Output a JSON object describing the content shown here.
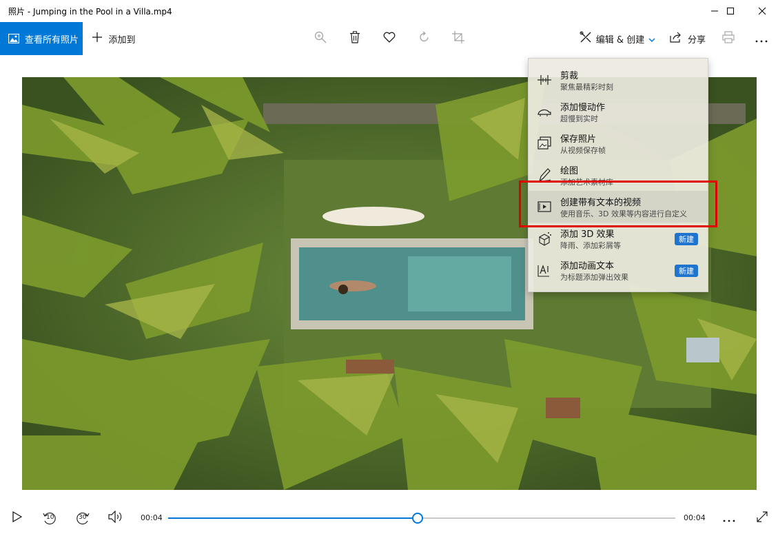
{
  "window": {
    "title": "照片 - Jumping in the Pool in a Villa.mp4",
    "minimize_icon": "minimize-icon",
    "maximize_icon": "maximize-icon",
    "close_icon": "close-icon"
  },
  "toolbar": {
    "see_all_label": "查看所有照片",
    "add_to_label": "添加到",
    "edit_create_label": "编辑 & 创建",
    "share_label": "分享",
    "accent_color": "#0078d7",
    "icons": [
      "zoom-icon",
      "delete-icon",
      "favorite-icon",
      "rotate-icon",
      "crop-icon",
      "print-icon",
      "more-icon"
    ]
  },
  "menu": {
    "items": [
      {
        "title": "剪裁",
        "subtitle": "聚焦最精彩时刻",
        "icon": "trim-icon",
        "badge": ""
      },
      {
        "title": "添加慢动作",
        "subtitle": "超慢到实时",
        "icon": "slow-motion-icon",
        "badge": ""
      },
      {
        "title": "保存照片",
        "subtitle": "从视频保存帧",
        "icon": "save-photo-icon",
        "badge": ""
      },
      {
        "title": "绘图",
        "subtitle": "添加艺术素材库",
        "icon": "draw-icon",
        "badge": ""
      },
      {
        "title": "创建带有文本的视频",
        "subtitle": "使用音乐、3D 效果等内容进行自定义",
        "icon": "video-text-icon",
        "badge": ""
      },
      {
        "title": "添加 3D 效果",
        "subtitle": "降雨、添加彩屑等",
        "icon": "3d-effects-icon",
        "badge": "新建"
      },
      {
        "title": "添加动画文本",
        "subtitle": "为标题添加弹出效果",
        "icon": "animated-text-icon",
        "badge": "新建"
      }
    ],
    "highlight_color": "#e00000",
    "badge_color": "#1f74d0"
  },
  "player": {
    "current_time": "00:04",
    "remaining_time": "00:04",
    "progress": 0.49,
    "skip_back_label": "10",
    "skip_forward_label": "30"
  }
}
